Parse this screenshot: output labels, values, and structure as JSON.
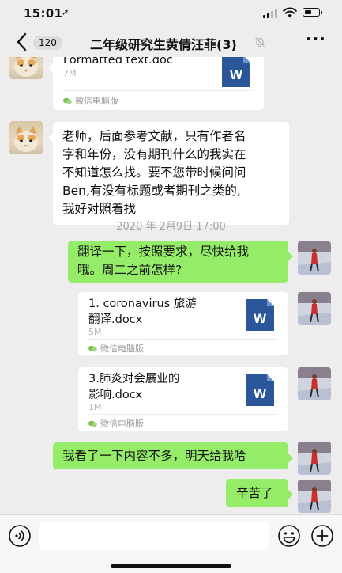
{
  "status_bar": {
    "time": "15:01",
    "battery_level": 0.5
  },
  "header": {
    "unread_count": "120",
    "title": "二年级研究生黄倩汪菲(3)"
  },
  "messages": {
    "file1": {
      "name": "Formatted text.doc",
      "size": "7M",
      "source": "微信电脑版"
    },
    "text1": {
      "lines": [
        "老师，后面参考文献，只有作者名",
        "字和年份，没有期刊什么的我实在",
        "不知道怎么找。要不您带时候问问",
        "Ben,有没有标题或者期刊之类的,",
        "我好对照着找"
      ]
    },
    "timestamp": "2020 年 2月9日 17:00",
    "text2": {
      "lines": [
        "翻译一下，按照要求，尽快给我",
        "哦。周二之前怎样?"
      ]
    },
    "file2": {
      "name_lines": [
        "1. coronavirus 旅游",
        "翻译.docx"
      ],
      "size": "5M",
      "source": "微信电脑版"
    },
    "file3": {
      "name_lines": [
        "3.肺炎对会展业的",
        "影响.docx"
      ],
      "size": "1M",
      "source": "微信电脑版"
    },
    "text3": {
      "text": "我看了一下内容不多，明天给我哈"
    },
    "text4": {
      "text": "辛苦了"
    }
  },
  "input": {
    "value": ""
  },
  "icons": {
    "back": "chevron-left-icon",
    "mute": "bell-off-icon",
    "more": "more-dots-icon",
    "voice": "voice-icon",
    "emoji": "emoji-icon",
    "plus": "plus-icon",
    "word": "word-doc-icon"
  },
  "colors": {
    "background": "#ededed",
    "bubble_green": "#95ec69",
    "bubble_white": "#ffffff",
    "word_blue": "#2b579a"
  }
}
